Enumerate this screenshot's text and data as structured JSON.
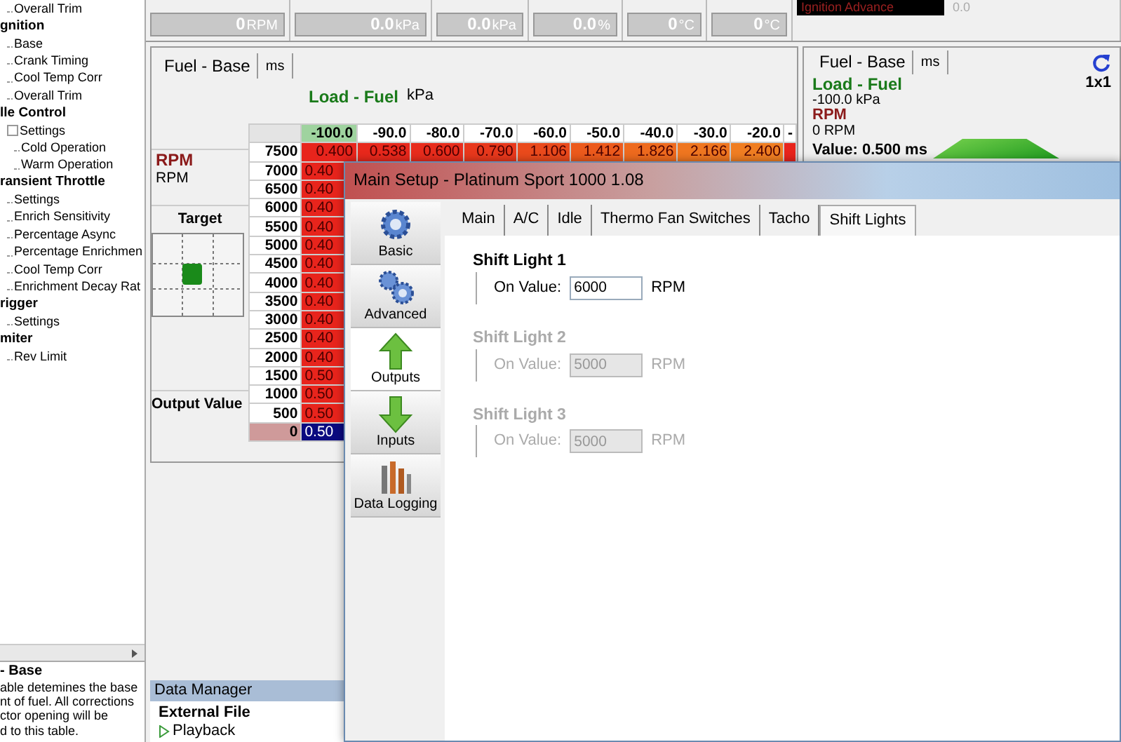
{
  "gauges": [
    {
      "value": "0",
      "unit": "RPM"
    },
    {
      "value": "0.0",
      "unit": "kPa"
    },
    {
      "value": "0.0",
      "unit": "kPa"
    },
    {
      "value": "0.0",
      "unit": "%"
    },
    {
      "value": "0",
      "unit": "°C"
    },
    {
      "value": "0",
      "unit": "°C"
    }
  ],
  "ignition_gauge": {
    "label": "Ignition Advance",
    "value": "0.0"
  },
  "tree": [
    {
      "kind": "leaf",
      "label": "Overall Trim"
    },
    {
      "kind": "group",
      "label": "gnition",
      "children": [
        {
          "label": "Base"
        },
        {
          "label": "Crank Timing"
        },
        {
          "label": "Cool Temp Corr"
        },
        {
          "label": "Overall Trim"
        }
      ]
    },
    {
      "kind": "group",
      "label": "lle Control",
      "children": [
        {
          "label": "Settings",
          "expanded": true,
          "children": [
            {
              "label": "Cold Operation"
            },
            {
              "label": "Warm Operation"
            }
          ]
        }
      ]
    },
    {
      "kind": "group",
      "label": "ransient Throttle",
      "children": [
        {
          "label": "Settings"
        },
        {
          "label": "Enrich Sensitivity"
        },
        {
          "label": "Percentage Async"
        },
        {
          "label": "Percentage Enrichmen"
        },
        {
          "label": "Cool Temp Corr"
        },
        {
          "label": "Enrichment Decay Rat"
        }
      ]
    },
    {
      "kind": "group",
      "label": "rigger",
      "children": [
        {
          "label": "Settings"
        }
      ]
    },
    {
      "kind": "group",
      "label": "miter",
      "children": [
        {
          "label": "Rev Limit"
        }
      ]
    }
  ],
  "description": {
    "title": "- Base",
    "lines": [
      "able detemines the base",
      "nt of fuel. All corrections",
      "ctor opening will be",
      "d to this table."
    ]
  },
  "table_panel": {
    "tabs": [
      "Fuel - Base",
      "ms"
    ],
    "x_axis": {
      "name": "Load - Fuel",
      "unit": "kPa"
    },
    "y_axis": {
      "name": "RPM",
      "unit": "RPM"
    },
    "target_label": "Target",
    "output_label": "Output Value",
    "columns": [
      {
        "label": "-100.0",
        "selected": true
      },
      {
        "label": "-90.0",
        "selected": false
      },
      {
        "label": "-80.0",
        "selected": false
      },
      {
        "label": "-70.0",
        "selected": false
      },
      {
        "label": "-60.0",
        "selected": false
      },
      {
        "label": "-50.0",
        "selected": false
      },
      {
        "label": "-40.0",
        "selected": false
      },
      {
        "label": "-30.0",
        "selected": false
      },
      {
        "label": "-20.0",
        "selected": false
      },
      {
        "label": "-",
        "selected": false
      }
    ],
    "rows": [
      {
        "label": "7500",
        "selected": false,
        "cells": [
          {
            "text": "0.400",
            "color": "#e8241c",
            "selected": false
          },
          {
            "text": "0.538",
            "color": "#e8281c",
            "selected": false
          },
          {
            "text": "0.600",
            "color": "#e82c1c",
            "selected": false
          },
          {
            "text": "0.790",
            "color": "#e8381c",
            "selected": false
          },
          {
            "text": "1.106",
            "color": "#ea4a1c",
            "selected": false
          },
          {
            "text": "1.412",
            "color": "#ec5a1c",
            "selected": false
          },
          {
            "text": "1.826",
            "color": "#ee6a1e",
            "selected": false
          },
          {
            "text": "2.166",
            "color": "#ef7620",
            "selected": false
          },
          {
            "text": "2.400",
            "color": "#f07e22",
            "selected": false
          }
        ]
      },
      {
        "label": "7000",
        "selected": false,
        "cells": [
          {
            "text": "0.40",
            "color": "#e8241c",
            "selected": false
          }
        ]
      },
      {
        "label": "6500",
        "selected": false,
        "cells": [
          {
            "text": "0.40",
            "color": "#e8241c",
            "selected": false
          }
        ]
      },
      {
        "label": "6000",
        "selected": false,
        "cells": [
          {
            "text": "0.40",
            "color": "#e8241c",
            "selected": false
          }
        ]
      },
      {
        "label": "5500",
        "selected": false,
        "cells": [
          {
            "text": "0.40",
            "color": "#e8241c",
            "selected": false
          }
        ]
      },
      {
        "label": "5000",
        "selected": false,
        "cells": [
          {
            "text": "0.40",
            "color": "#e8241c",
            "selected": false
          }
        ]
      },
      {
        "label": "4500",
        "selected": false,
        "cells": [
          {
            "text": "0.40",
            "color": "#e8241c",
            "selected": false
          }
        ]
      },
      {
        "label": "4000",
        "selected": false,
        "cells": [
          {
            "text": "0.40",
            "color": "#e8241c",
            "selected": false
          }
        ]
      },
      {
        "label": "3500",
        "selected": false,
        "cells": [
          {
            "text": "0.40",
            "color": "#e8241c",
            "selected": false
          }
        ]
      },
      {
        "label": "3000",
        "selected": false,
        "cells": [
          {
            "text": "0.40",
            "color": "#e8241c",
            "selected": false
          }
        ]
      },
      {
        "label": "2500",
        "selected": false,
        "cells": [
          {
            "text": "0.40",
            "color": "#e8241c",
            "selected": false
          }
        ]
      },
      {
        "label": "2000",
        "selected": false,
        "cells": [
          {
            "text": "0.40",
            "color": "#e8241c",
            "selected": false
          }
        ]
      },
      {
        "label": "1500",
        "selected": false,
        "cells": [
          {
            "text": "0.50",
            "color": "#e8241c",
            "selected": false
          }
        ]
      },
      {
        "label": "1000",
        "selected": false,
        "cells": [
          {
            "text": "0.50",
            "color": "#e8241c",
            "selected": false
          }
        ]
      },
      {
        "label": "500",
        "selected": false,
        "cells": [
          {
            "text": "0.50",
            "color": "#e8241c",
            "selected": false
          }
        ]
      },
      {
        "label": "0",
        "selected": true,
        "cells": [
          {
            "text": "0.50",
            "selected": true
          }
        ]
      }
    ]
  },
  "side_panel": {
    "tabs": [
      "Fuel - Base",
      "ms"
    ],
    "load_name": "Load - Fuel",
    "size": "1x1",
    "load_value": "-100.0 kPa",
    "rpm_name": "RPM",
    "rpm_value": "0 RPM",
    "value": "Value: 0.500 ms"
  },
  "data_manager": {
    "title": "Data Manager",
    "section": "External File",
    "items": [
      "Playback"
    ]
  },
  "dialog": {
    "title": "Main Setup - Platinum Sport 1000 1.08",
    "nav": [
      {
        "label": "Basic",
        "kind": "gear",
        "selected": false
      },
      {
        "label": "Advanced",
        "kind": "gears",
        "selected": false
      },
      {
        "label": "Outputs",
        "kind": "up",
        "selected": true
      },
      {
        "label": "Inputs",
        "kind": "down",
        "selected": false
      },
      {
        "label": "Data Logging",
        "kind": "chart",
        "selected": false
      }
    ],
    "tabs": [
      {
        "label": "Main",
        "selected": false
      },
      {
        "label": "A/C",
        "selected": false
      },
      {
        "label": "Idle",
        "selected": false
      },
      {
        "label": "Thermo Fan Switches",
        "selected": false
      },
      {
        "label": "Tacho",
        "selected": false
      },
      {
        "label": "Shift Lights",
        "selected": true
      }
    ],
    "groups": [
      {
        "title": "Shift Light 1",
        "label": "On Value:",
        "value": "6000",
        "unit": "RPM",
        "disabled": false
      },
      {
        "title": "Shift Light 2",
        "label": "On Value:",
        "value": "5000",
        "unit": "RPM",
        "disabled": true
      },
      {
        "title": "Shift Light 3",
        "label": "On Value:",
        "value": "5000",
        "unit": "RPM",
        "disabled": true
      }
    ]
  }
}
